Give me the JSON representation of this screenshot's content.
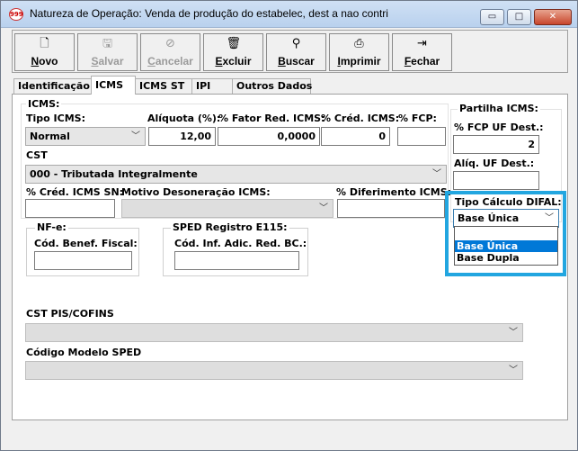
{
  "window": {
    "title": "Natureza de Operação:  Venda de produção do estabelec, dest a nao contri",
    "icon": "999",
    "min_glyph": "▭",
    "max_glyph": "□",
    "close_glyph": "✕"
  },
  "toolbar": {
    "buttons": [
      {
        "label": "Novo",
        "icon": "new-document-icon",
        "glyph": "🗋",
        "enabled": true
      },
      {
        "label": "Salvar",
        "icon": "save-icon",
        "glyph": "🖫",
        "enabled": false
      },
      {
        "label": "Cancelar",
        "icon": "cancel-icon",
        "glyph": "⊘",
        "enabled": false
      },
      {
        "label": "Excluir",
        "icon": "trash-icon",
        "glyph": "🗑",
        "enabled": true
      },
      {
        "label": "Buscar",
        "icon": "binoculars-icon",
        "glyph": "⚲",
        "enabled": true
      },
      {
        "label": "Imprimir",
        "icon": "printer-icon",
        "glyph": "⎙",
        "enabled": true
      },
      {
        "label": "Fechar",
        "icon": "exit-icon",
        "glyph": "⇥",
        "enabled": true
      }
    ]
  },
  "tabs": [
    "Identificação",
    "ICMS",
    "ICMS ST",
    "IPI",
    "Outros Dados"
  ],
  "active_tab": "ICMS",
  "icms": {
    "section_label": "ICMS:",
    "tipo_icms_label": "Tipo ICMS:",
    "tipo_icms_value": "Normal",
    "aliquota_label": "Alíquota (%):",
    "aliquota_value": "12,00",
    "fator_red_label": "% Fator Red. ICMS:",
    "fator_red_value": "0,0000",
    "cred_icms_label": "% Créd. ICMS:",
    "cred_icms_value": "0",
    "fcp_label": "% FCP:",
    "fcp_value": "",
    "cst_label": "CST",
    "cst_value": "000 - Tributada Integralmente",
    "cred_sn_label": "% Créd. ICMS SN:",
    "cred_sn_value": "",
    "motivo_label": "Motivo Desoneração ICMS:",
    "motivo_value": "",
    "diferimento_label": "% Diferimento ICMS:",
    "diferimento_value": ""
  },
  "partilha": {
    "label": "Partilha ICMS:",
    "fcp_uf_label": "% FCP UF Dest.:",
    "fcp_uf_value": "2",
    "aliq_uf_label": "Alíq. UF Dest.:",
    "aliq_uf_value": "",
    "difal_label": "Tipo Cálculo DIFAL:",
    "difal_value": "Base Única",
    "difal_options": [
      "",
      "Base Única",
      "Base Dupla"
    ],
    "difal_selected_index": 1
  },
  "nfe": {
    "label": "NF-e:",
    "cod_benef_label": "Cód. Benef. Fiscal:",
    "cod_benef_value": ""
  },
  "sped": {
    "label": "SPED Registro E115:",
    "cod_inf_label": "Cód. Inf. Adic. Red. BC.:",
    "cod_inf_value": ""
  },
  "pis_cofins": {
    "label": "CST PIS/COFINS",
    "value": ""
  },
  "modelo_sped": {
    "label": "Código Modelo SPED",
    "value": ""
  },
  "colors": {
    "highlight": "#22a6e0",
    "selected_option": "#0078d7"
  }
}
